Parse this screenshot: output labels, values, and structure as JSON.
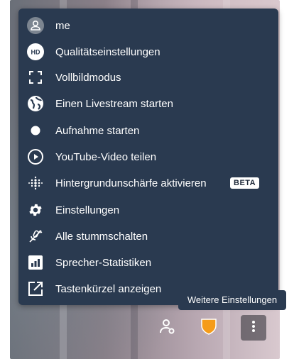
{
  "menu": {
    "items": [
      {
        "label": "me",
        "icon": "avatar-icon"
      },
      {
        "label": "Qualitätseinstellungen",
        "icon": "hd-icon",
        "icon_text": "HD"
      },
      {
        "label": "Vollbildmodus",
        "icon": "fullscreen-icon"
      },
      {
        "label": "Einen Livestream starten",
        "icon": "globe-icon"
      },
      {
        "label": "Aufnahme starten",
        "icon": "record-icon"
      },
      {
        "label": "YouTube-Video teilen",
        "icon": "play-circle-icon"
      },
      {
        "label": "Hintergrundunschärfe aktivieren",
        "icon": "blur-dots-icon",
        "badge": "BETA"
      },
      {
        "label": "Einstellungen",
        "icon": "gear-icon"
      },
      {
        "label": "Alle stummschalten",
        "icon": "mic-off-icon"
      },
      {
        "label": "Sprecher-Statistiken",
        "icon": "bar-chart-icon"
      },
      {
        "label": "Tastenkürzel anzeigen",
        "icon": "external-square-icon"
      }
    ]
  },
  "tooltip": {
    "text": "Weitere Einstellungen"
  },
  "toolbar": {
    "buttons": [
      {
        "name": "invite-people",
        "icon": "person-add-icon"
      },
      {
        "name": "security",
        "icon": "shield-icon"
      },
      {
        "name": "more-options",
        "icon": "more-vertical-icon"
      }
    ]
  },
  "colors": {
    "menu_bg": "#2a3a50",
    "text": "#ffffff",
    "shield": "#f59c1a",
    "avatar_bg": "#7c8590"
  }
}
